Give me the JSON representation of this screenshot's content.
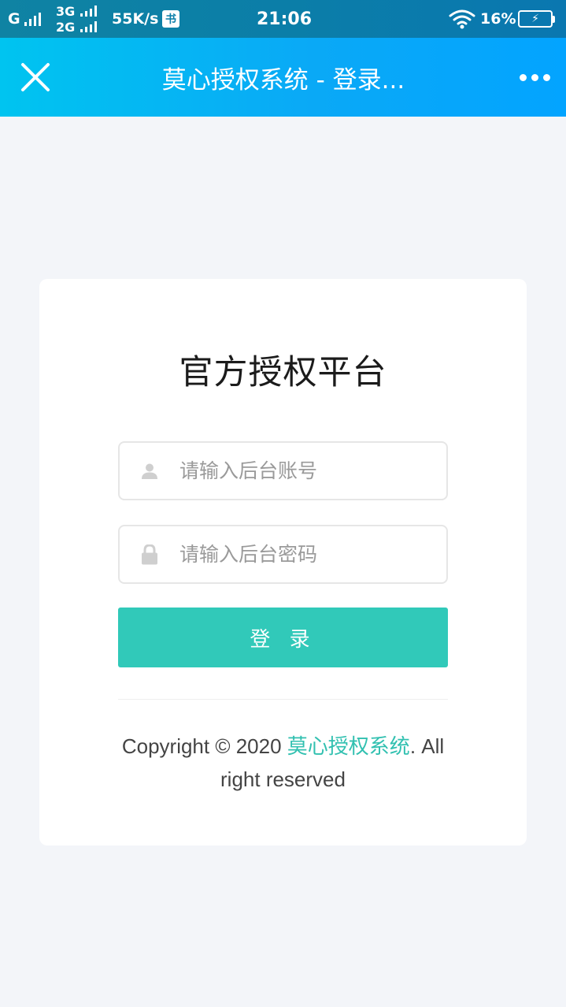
{
  "status_bar": {
    "network_primary": "G",
    "network_secondary_top": "3G",
    "network_secondary_bottom": "2G",
    "speed": "55K/s",
    "speed_icon": "书",
    "time": "21:06",
    "battery_percent": "16%",
    "icons": [
      "signal-bars-icon",
      "data-speed-icon",
      "wifi-icon",
      "battery-charging-icon"
    ]
  },
  "title_bar": {
    "title": "莫心授权系统 - 登录...",
    "close_icon": "close-icon",
    "more_icon": "more-dots-icon"
  },
  "login": {
    "heading": "官方授权平台",
    "username_placeholder": "请输入后台账号",
    "username_value": "",
    "password_placeholder": "请输入后台密码",
    "password_value": "",
    "submit_label": "登 录",
    "icons": [
      "user-icon",
      "lock-icon"
    ]
  },
  "footer": {
    "copyright_prefix": "Copyright © 2020 ",
    "brand": "莫心授权系统",
    "copyright_suffix": ". All right reserved"
  },
  "colors": {
    "accent": "#31c9b9",
    "header_start": "#00c4f0",
    "header_end": "#03a4ff",
    "background": "#f3f5f9"
  }
}
